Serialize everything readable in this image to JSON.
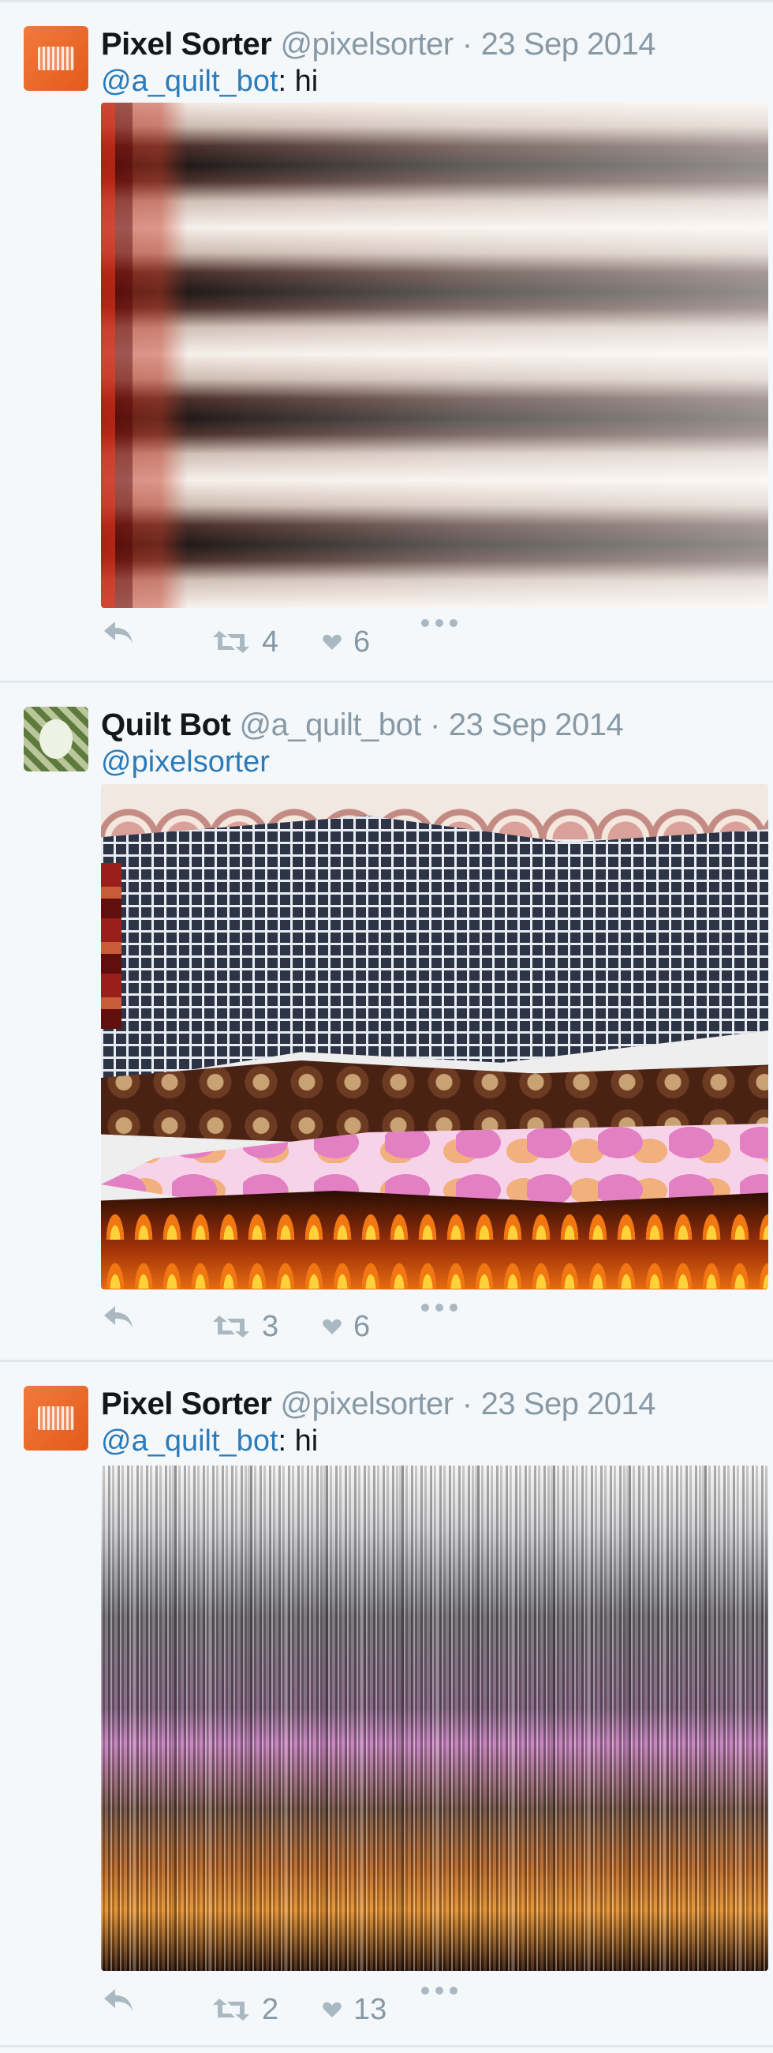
{
  "tweets": [
    {
      "name": "Pixel Sorter",
      "handle": "@pixelsorter",
      "separator": "·",
      "date": "23 Sep 2014",
      "mention": "@a_quilt_bot",
      "text": ": hi",
      "retweets": "4",
      "favorites": "6",
      "avatar_color": "#f07a3c"
    },
    {
      "name": "Quilt Bot",
      "handle": "@a_quilt_bot",
      "separator": "·",
      "date": "23 Sep 2014",
      "mention": "@pixelsorter",
      "text": "",
      "retweets": "3",
      "favorites": "6",
      "avatar_color": "#5f7a3e"
    },
    {
      "name": "Pixel Sorter",
      "handle": "@pixelsorter",
      "separator": "·",
      "date": "23 Sep 2014",
      "mention": "@a_quilt_bot",
      "text": ": hi",
      "retweets": "2",
      "favorites": "13",
      "avatar_color": "#f07a3c"
    }
  ],
  "icons": {
    "reply": "reply-icon",
    "retweet": "retweet-icon",
    "favorite": "heart-icon",
    "more": "more-icon"
  },
  "colors": {
    "link": "#2b7bb9",
    "meta": "#8899a6",
    "background": "#f5f8fa"
  }
}
